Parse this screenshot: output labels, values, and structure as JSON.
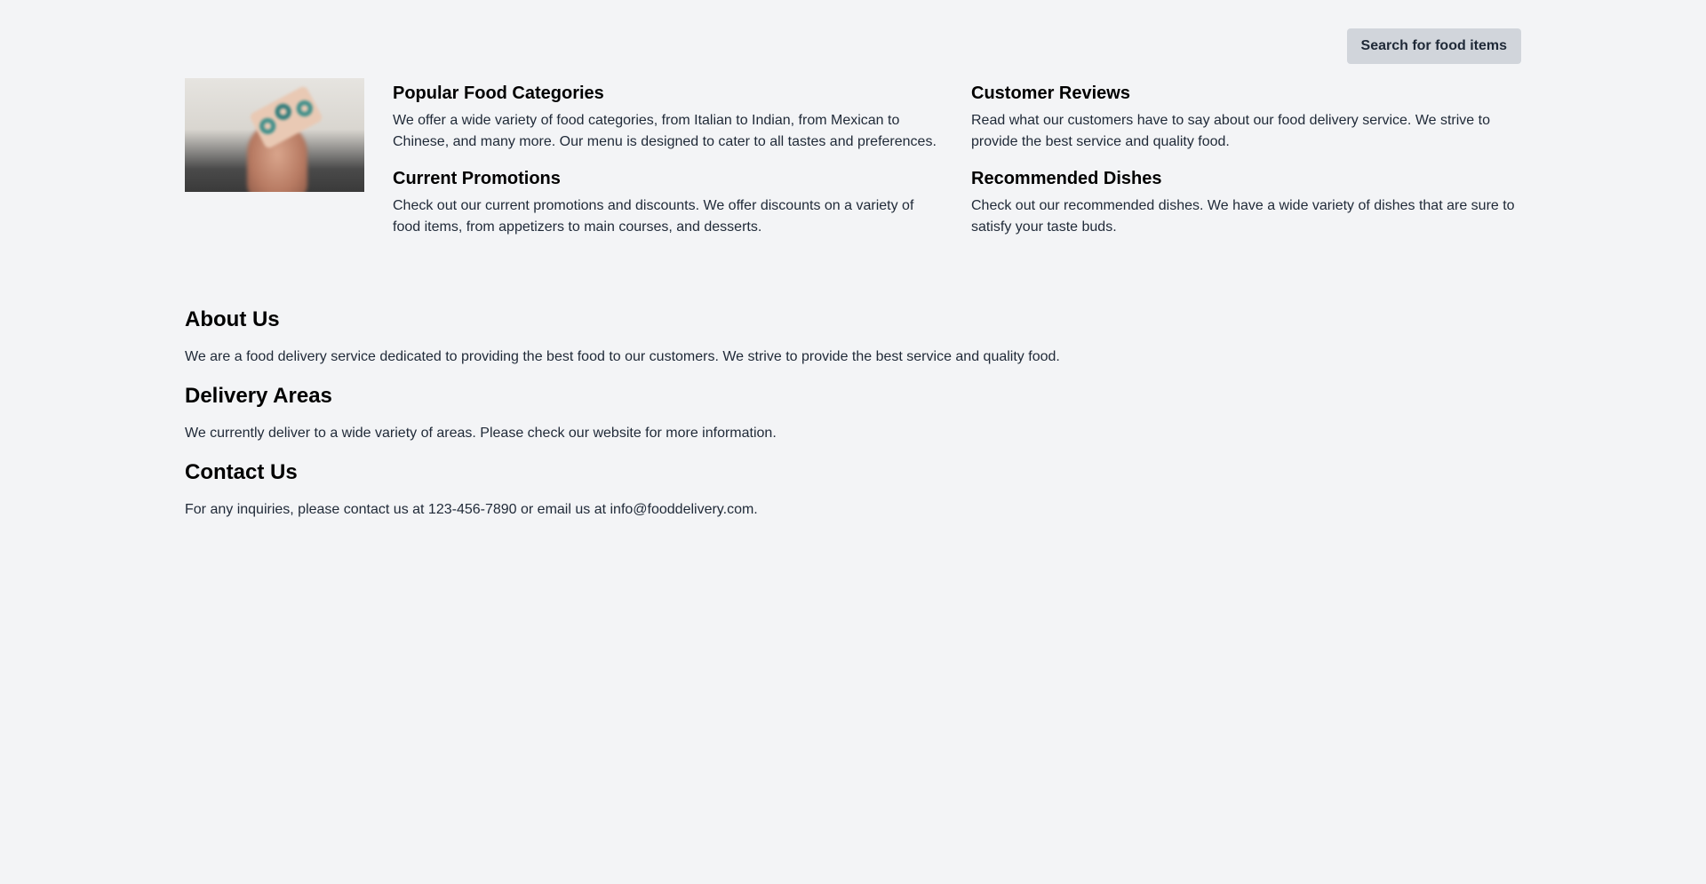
{
  "header": {
    "search_button_label": "Search for food items"
  },
  "hero": {
    "image_icon": "food-delivery-photo",
    "popular": {
      "title": "Popular Food Categories",
      "text": "We offer a wide variety of food categories, from Italian to Indian, from Mexican to Chinese, and many more. Our menu is designed to cater to all tastes and preferences."
    },
    "promotions": {
      "title": "Current Promotions",
      "text": "Check out our current promotions and discounts. We offer discounts on a variety of food items, from appetizers to main courses, and desserts."
    },
    "reviews": {
      "title": "Customer Reviews",
      "text": "Read what our customers have to say about our food delivery service. We strive to provide the best service and quality food."
    },
    "recommended": {
      "title": "Recommended Dishes",
      "text": "Check out our recommended dishes. We have a wide variety of dishes that are sure to satisfy your taste buds."
    }
  },
  "info": {
    "about": {
      "title": "About Us",
      "text": "We are a food delivery service dedicated to providing the best food to our customers. We strive to provide the best service and quality food."
    },
    "areas": {
      "title": "Delivery Areas",
      "text": "We currently deliver to a wide variety of areas. Please check our website for more information."
    },
    "contact": {
      "title": "Contact Us",
      "text": "For any inquiries, please contact us at 123-456-7890 or email us at info@fooddelivery.com."
    }
  },
  "colors": {
    "background": "#f3f4f6",
    "button_bg": "#d1d5db",
    "text": "#1f2937",
    "heading": "#000000"
  }
}
